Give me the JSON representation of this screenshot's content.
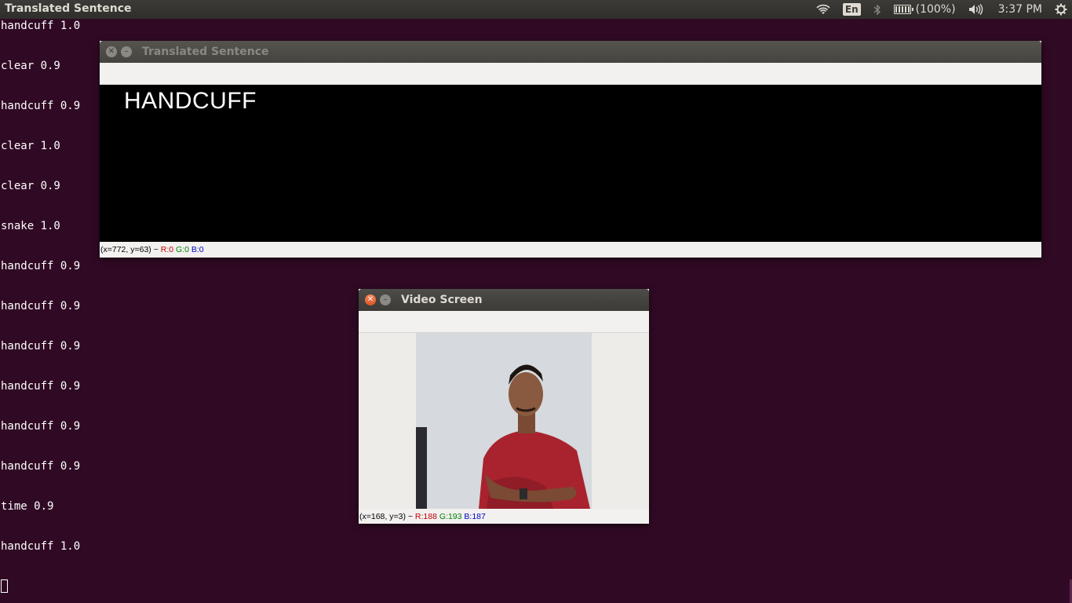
{
  "top_panel": {
    "app_title": "Translated Sentence",
    "indicators": {
      "keyboard_layout": "En",
      "battery": "(100%)",
      "clock": "3:37 PM"
    },
    "icons": [
      "wifi-icon",
      "bluetooth-icon",
      "battery-icon",
      "volume-icon",
      "settings-gear-icon"
    ]
  },
  "terminal": {
    "lines": [
      "handcuff 1.0",
      "clear 0.9",
      "handcuff 0.9",
      "clear 1.0",
      "clear 0.9",
      "snake 1.0",
      "handcuff 0.9",
      "handcuff 0.9",
      "handcuff 0.9",
      "handcuff 0.9",
      "handcuff 0.9",
      "handcuff 0.9",
      "time 0.9",
      "handcuff 1.0"
    ]
  },
  "translated_window": {
    "title": "Translated Sentence",
    "text": "HANDCUFF",
    "status": {
      "coords": "(x=772, y=63) ~ ",
      "r": "R:0",
      "g": "G:0",
      "b": "B:0"
    }
  },
  "video_window": {
    "title": "Video Screen",
    "status": {
      "coords": "(x=168, y=3) ~ ",
      "r": "R:188",
      "g": "G:193",
      "b": "B:187"
    }
  },
  "colors": {
    "desktop_bg": "#300a24",
    "panel_bg": "#3c3b37",
    "close_button": "#e25422"
  }
}
